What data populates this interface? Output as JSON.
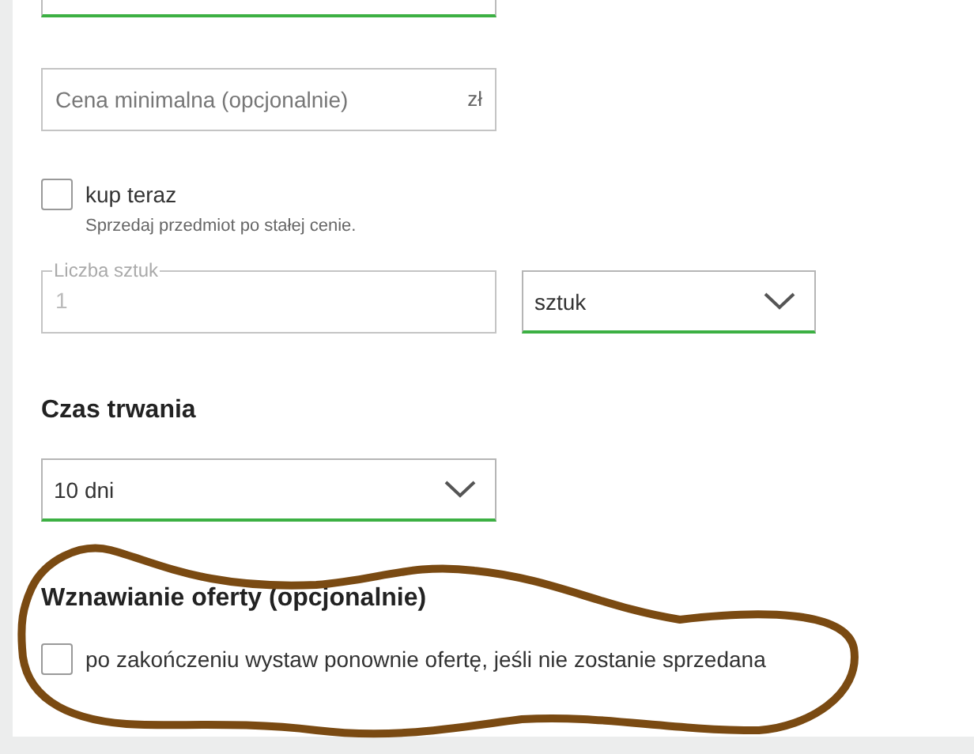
{
  "min_price": {
    "placeholder": "Cena minimalna (opcjonalnie)",
    "suffix": "zł"
  },
  "buy_now": {
    "label": "kup teraz",
    "checked": false,
    "hint": "Sprzedaj przedmiot po stałej cenie."
  },
  "quantity": {
    "label": "Liczba sztuk",
    "value": "1",
    "disabled": true
  },
  "unit": {
    "value": "sztuk"
  },
  "duration": {
    "heading": "Czas trwania",
    "value": "10 dni"
  },
  "relist": {
    "heading": "Wznawianie oferty (opcjonalnie)",
    "label": "po zakończeniu wystaw ponownie ofertę, jeśli nie zostanie sprzedana",
    "checked": false
  }
}
